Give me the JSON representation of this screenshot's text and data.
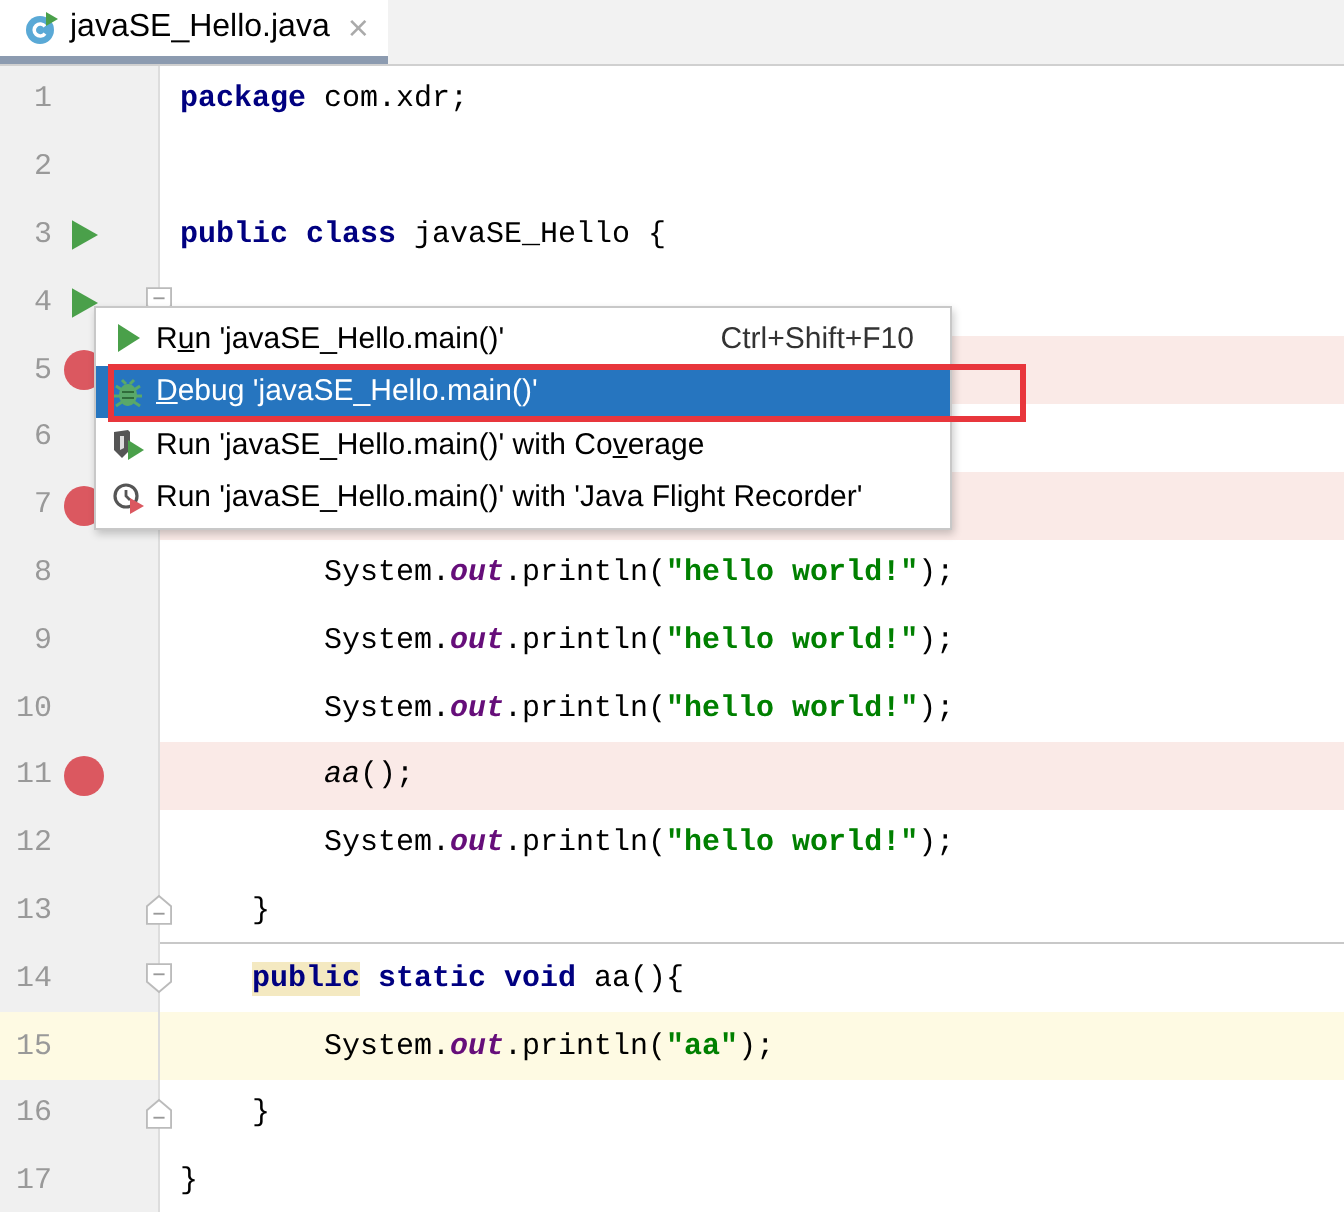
{
  "tab": {
    "title": "javaSE_Hello.java",
    "close": "×",
    "selected": true
  },
  "lines": [
    {
      "number": "1",
      "tokens": [
        {
          "t": "package",
          "kind": "keyword"
        },
        {
          "t": " com.xdr;",
          "kind": "plain"
        }
      ]
    },
    {
      "number": "2"
    },
    {
      "number": "3",
      "run": true,
      "tokens": [
        {
          "t": "public class",
          "kind": "keyword"
        },
        {
          "t": " javaSE_Hello {",
          "kind": "plain"
        }
      ],
      "children": [
        {
          "number": "4",
          "run": true,
          "fold_open": true,
          "children": [
            {
              "number": "5",
              "breakpoint": true
            },
            {
              "number": "6"
            },
            {
              "number": "7",
              "breakpoint": true
            },
            {
              "number": "8",
              "tokens": [
                {
                  "t": "System.",
                  "kind": "plain"
                },
                {
                  "t": "out",
                  "kind": "field"
                },
                {
                  "t": ".println(",
                  "kind": "plain"
                },
                {
                  "t": "\"hello world!\"",
                  "kind": "string"
                },
                {
                  "t": ");",
                  "kind": "plain"
                }
              ]
            },
            {
              "number": "9",
              "tokens": [
                {
                  "t": "System.",
                  "kind": "plain"
                },
                {
                  "t": "out",
                  "kind": "field"
                },
                {
                  "t": ".println(",
                  "kind": "plain"
                },
                {
                  "t": "\"hello world!\"",
                  "kind": "string"
                },
                {
                  "t": ");",
                  "kind": "plain"
                }
              ]
            },
            {
              "number": "10",
              "tokens": [
                {
                  "t": "System.",
                  "kind": "plain"
                },
                {
                  "t": "out",
                  "kind": "field"
                },
                {
                  "t": ".println(",
                  "kind": "plain"
                },
                {
                  "t": "\"hello world!\"",
                  "kind": "string"
                },
                {
                  "t": ");",
                  "kind": "plain"
                }
              ]
            },
            {
              "number": "11",
              "breakpoint": true,
              "tokens": [
                {
                  "t": "aa",
                  "kind": "call"
                },
                {
                  "t": "();",
                  "kind": "plain"
                }
              ]
            },
            {
              "number": "12",
              "tokens": [
                {
                  "t": "System.",
                  "kind": "plain"
                },
                {
                  "t": "out",
                  "kind": "field"
                },
                {
                  "t": ".println(",
                  "kind": "plain"
                },
                {
                  "t": "\"hello world!\"",
                  "kind": "string"
                },
                {
                  "t": ");",
                  "kind": "plain"
                }
              ]
            }
          ]
        },
        {
          "number": "13",
          "fold_close": true,
          "separator": true,
          "tokens": [
            {
              "t": "}",
              "kind": "plain"
            }
          ]
        },
        {
          "number": "14",
          "fold_open": true,
          "tokens": [
            {
              "t": "public",
              "kind": "keyword-usage"
            },
            {
              "t": " static void",
              "kind": "keyword"
            },
            {
              "t": " aa(){",
              "kind": "plain"
            }
          ],
          "children": [
            {
              "number": "15",
              "caret": true,
              "tokens": [
                {
                  "t": "System.",
                  "kind": "plain"
                },
                {
                  "t": "out",
                  "kind": "field"
                },
                {
                  "t": ".println(",
                  "kind": "plain"
                },
                {
                  "t": "\"aa\"",
                  "kind": "string"
                },
                {
                  "t": ");",
                  "kind": "plain"
                }
              ]
            }
          ]
        },
        {
          "number": "16",
          "fold_close": true,
          "tokens": [
            {
              "t": "}",
              "kind": "plain"
            }
          ]
        }
      ]
    },
    {
      "number": "17",
      "tokens": [
        {
          "t": "}",
          "kind": "plain"
        }
      ]
    }
  ],
  "menu": {
    "items": [
      {
        "kind": "run",
        "pre": "R",
        "mnemonic": "u",
        "post": "n 'javaSE_Hello.main()'",
        "shortcut": "Ctrl+Shift+F10",
        "selected": false
      },
      {
        "kind": "debug",
        "mnemonic": "D",
        "post": "ebug 'javaSE_Hello.main()'",
        "selected": true,
        "framed": true
      },
      {
        "kind": "coverage",
        "pre": "Run 'javaSE_Hello.main()' with Co",
        "mnemonic": "v",
        "post": "erage",
        "selected": false
      },
      {
        "kind": "profiler",
        "pre": "Run 'javaSE_Hello.main()' with 'Java Flight Recorder'",
        "selected": false
      }
    ]
  }
}
